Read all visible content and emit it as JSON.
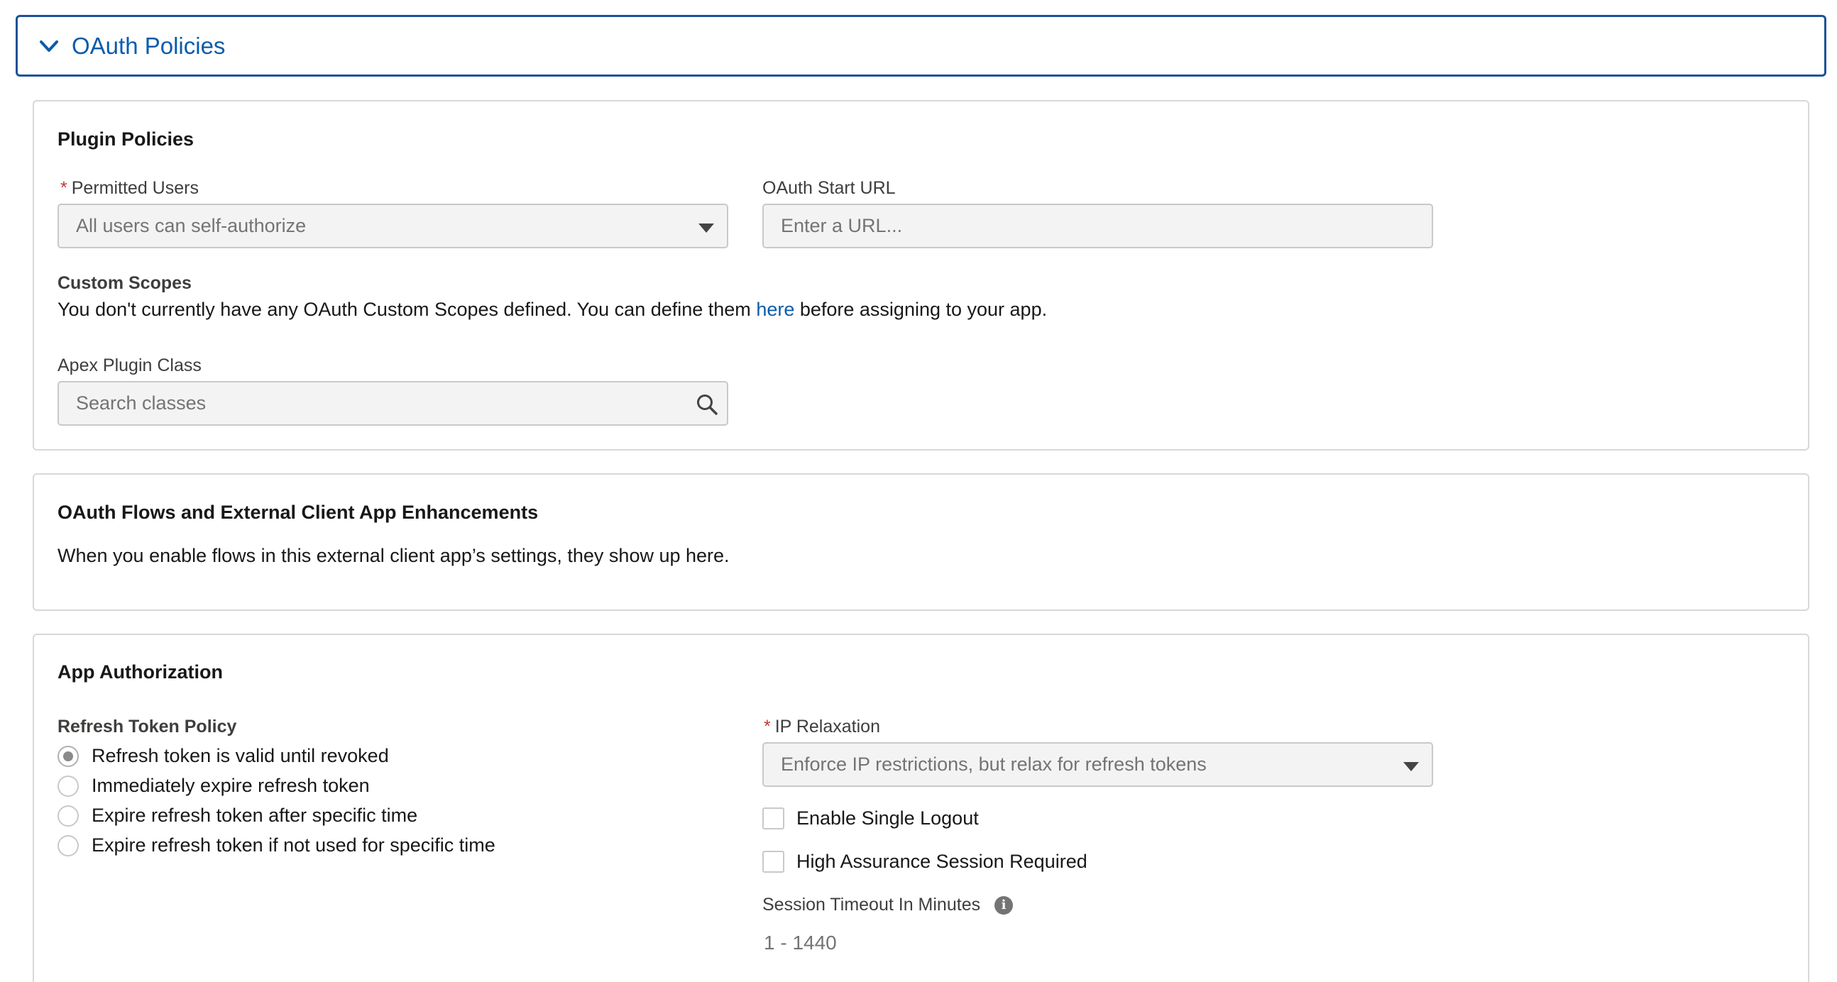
{
  "accordion": {
    "title": "OAuth Policies"
  },
  "plugin_policies": {
    "title": "Plugin Policies",
    "permitted_users": {
      "required_mark": "*",
      "label": "Permitted Users",
      "value": "All users can self-authorize"
    },
    "oauth_start_url": {
      "label": "OAuth Start URL",
      "placeholder": "Enter a URL..."
    },
    "custom_scopes": {
      "label": "Custom Scopes",
      "text_before": "You don't currently have any OAuth Custom Scopes defined. You can define them ",
      "link": "here",
      "text_after": " before assigning to your app."
    },
    "apex_plugin_class": {
      "label": "Apex Plugin Class",
      "placeholder": "Search classes"
    }
  },
  "oauth_flows": {
    "title": "OAuth Flows and External Client App Enhancements",
    "description": "When you enable flows in this external client app’s settings, they show up here."
  },
  "app_authorization": {
    "title": "App Authorization",
    "refresh_token_policy": {
      "label": "Refresh Token Policy",
      "options": [
        {
          "label": "Refresh token is valid until revoked",
          "checked": true
        },
        {
          "label": "Immediately expire refresh token",
          "checked": false
        },
        {
          "label": "Expire refresh token after specific time",
          "checked": false
        },
        {
          "label": "Expire refresh token if not used for specific time",
          "checked": false
        }
      ]
    },
    "ip_relaxation": {
      "required_mark": "*",
      "label": "IP Relaxation",
      "value": "Enforce IP restrictions, but relax for refresh tokens"
    },
    "enable_single_logout": {
      "label": "Enable Single Logout",
      "checked": false
    },
    "high_assurance": {
      "label": "High Assurance Session Required",
      "checked": false
    },
    "session_timeout": {
      "label": "Session Timeout In Minutes",
      "info_icon": "info-icon",
      "hint": "1 - 1440"
    }
  }
}
